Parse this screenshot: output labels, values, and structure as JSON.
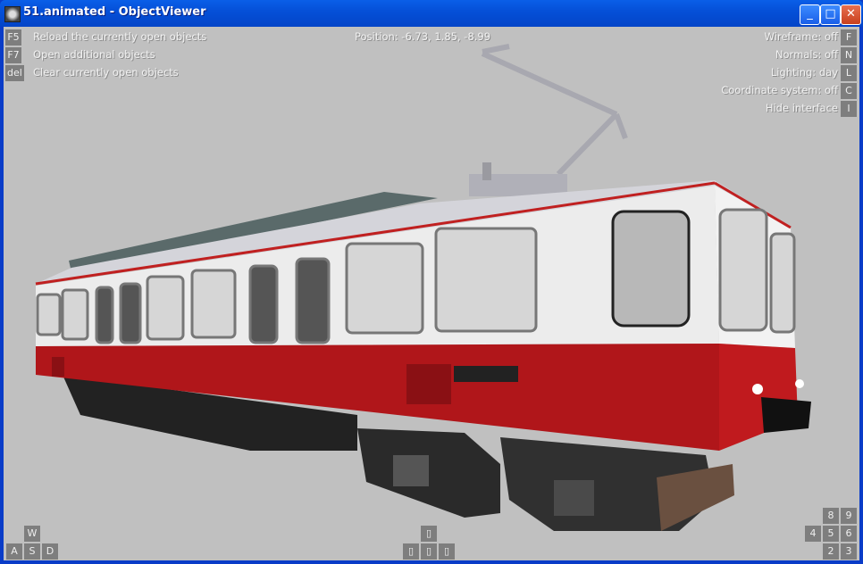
{
  "window": {
    "title": "51.animated - ObjectViewer",
    "minimize_icon": "minimize-icon",
    "maximize_icon": "maximize-icon",
    "close_icon": "close-icon"
  },
  "left_commands": [
    {
      "key": "F5",
      "label": "Reload the currently open objects"
    },
    {
      "key": "F7",
      "label": "Open additional objects"
    },
    {
      "key": "del",
      "label": "Clear currently open objects"
    }
  ],
  "position": "Position: -6.73, 1.85, -8.99",
  "right_toggles": [
    {
      "key": "F",
      "label": "Wireframe: off"
    },
    {
      "key": "N",
      "label": "Normals: off"
    },
    {
      "key": "L",
      "label": "Lighting: day"
    },
    {
      "key": "C",
      "label": "Coordinate system: off"
    },
    {
      "key": "I",
      "label": "Hide interface"
    }
  ],
  "movement_keys": {
    "w": "W",
    "a": "A",
    "s": "S",
    "d": "D"
  },
  "arrow_keys": {
    "up": "▯",
    "left": "▯",
    "down": "▯",
    "right": "▯"
  },
  "numpad_keys": {
    "k8": "8",
    "k9": "9",
    "k4": "4",
    "k5": "5",
    "k6": "6",
    "k2": "2",
    "k3": "3"
  },
  "scene": {
    "object": "tram-model",
    "colors": {
      "body_white": "#ececec",
      "body_red": "#b0161a",
      "roof": "#c8c8cc",
      "background": "#c0c0c0"
    }
  }
}
